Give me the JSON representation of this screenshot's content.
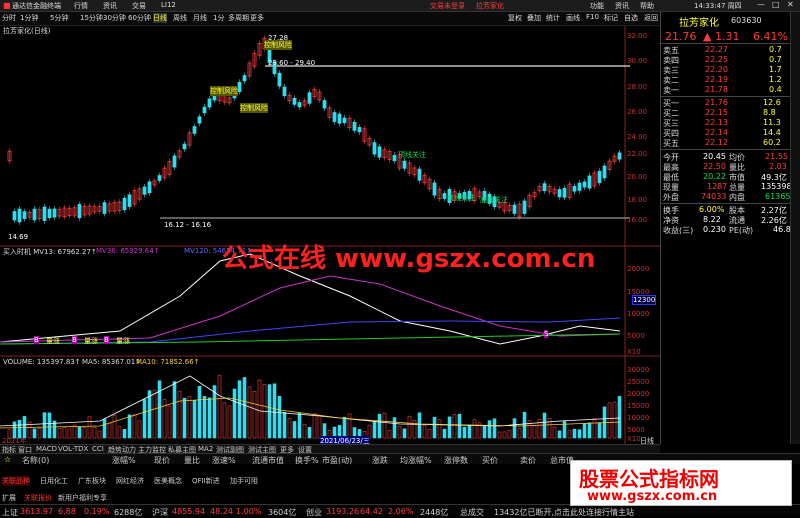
{
  "titlebar": {
    "app": "通达信金融终端",
    "menus": [
      "行情",
      "资讯",
      "交易",
      "LI12"
    ],
    "center1": "交易未登录",
    "center2": "拉芳家化",
    "right": [
      "功能",
      "资讯",
      "帮助"
    ],
    "time": "14:33:47 周四"
  },
  "menubar": {
    "left_items": [
      "分时",
      "1分钟",
      "5分钟",
      "15分钟",
      "30分钟",
      "60分钟",
      "日线",
      "周线",
      "月线",
      "1分",
      "多周期",
      "更多"
    ],
    "right_items": [
      "复权",
      "叠加",
      "统计",
      "画线",
      "F10",
      "标记",
      "自选",
      "返回"
    ]
  },
  "chart_title": "拉芳家化(日线)",
  "price_chart": {
    "annotations": [
      "控制风险",
      "控制风险",
      "控制风险",
      "顶线关注",
      "底线关注",
      "底线关注"
    ],
    "peak_label": "27.28",
    "range1": "29.60 - 29.40",
    "range2": "16.12 - 16.16",
    "low_label": "14.69",
    "axis": [
      "32.00",
      "30.00",
      "28.00",
      "26.00",
      "24.00",
      "22.00",
      "20.00",
      "18.00",
      "16.00"
    ],
    "markers": [
      "B",
      "B",
      "S",
      "B",
      "M"
    ]
  },
  "indicator_panel": {
    "header": "买入时机  MV13: 67962.27↑",
    "mv36": "MV36: 65929.64↑",
    "mv120": "MV120: 54654.71↑",
    "axis": [
      "20000",
      "15000",
      "10000",
      "5000",
      "X10"
    ],
    "current": "12300",
    "markers": [
      "B",
      "B",
      "B",
      "B",
      "B",
      "B",
      "S"
    ],
    "labels": [
      "量涨",
      "量涨",
      "量涨"
    ]
  },
  "volume_panel": {
    "header": "VOLUME: 135397.83↑",
    "ma5": "MA5: 85367.01↑",
    "ma10": "MA10: 71852.66↑",
    "axis": [
      "30000",
      "25000",
      "20000",
      "15000",
      "10000",
      "5000",
      "X10"
    ],
    "date_tag": "2021/06/23/三",
    "year_left": "2021年",
    "bottom_right": "日线"
  },
  "tabbar": [
    "指标",
    "窗口",
    "MACD",
    "VOL-TDX",
    "CCI",
    "趋势动力",
    "主力监控",
    "私募主图",
    "MA2",
    "测试副图",
    "测试主图",
    "更多",
    "设置"
  ],
  "colhdr": [
    "名称(0)",
    "涨幅%",
    "现价",
    "量比",
    "涨速%",
    "流通市值",
    "换手%",
    "市盈(动)",
    "涨跌",
    "均涨幅%",
    "涨停数",
    "买价",
    "卖价",
    "总市值"
  ],
  "bottom_tabs": [
    "关联品种",
    "日用化工",
    "广东板块",
    "网红经济",
    "医美概念",
    "QFII新进",
    "加手可阻"
  ],
  "bottom_sub": [
    "扩展",
    "关联报价",
    "新用户福利专享"
  ],
  "stock": {
    "name": "拉芳家化",
    "code": "603630",
    "price": "21.76",
    "change": "1.31",
    "pct": "6.41%"
  },
  "asks": [
    [
      "卖五",
      "22.27",
      "2"
    ],
    [
      "卖四",
      "22.25",
      "7"
    ],
    [
      "卖三",
      "22.20",
      "7"
    ],
    [
      "卖二",
      "22.19",
      "2"
    ],
    [
      "卖一",
      "21.78",
      "4"
    ]
  ],
  "bids": [
    [
      "买一",
      "21.76",
      "12"
    ],
    [
      "买二",
      "22.15",
      "8"
    ],
    [
      "买三",
      "22.13",
      "11"
    ],
    [
      "买四",
      "22.14",
      "14"
    ],
    [
      "买五",
      "22.12",
      "60"
    ]
  ],
  "ask_ext": [
    "0.7",
    "0.7",
    "1.7",
    "1.2",
    "0.4"
  ],
  "bid_ext": [
    "12.6",
    "8.8",
    "11.3",
    "14.4",
    "60.2"
  ],
  "stats": [
    [
      "今开",
      "20.45",
      "均价",
      "21.55"
    ],
    [
      "最高",
      "22.50",
      "量比",
      "2.03"
    ],
    [
      "最低",
      "20.22",
      "市值",
      "49.3亿"
    ],
    [
      "现量",
      "1287",
      "总量",
      "135398"
    ],
    [
      "外盘",
      "74033",
      "内盘",
      "61365"
    ],
    [
      "换手",
      "6.00%",
      "股本",
      "2.27亿"
    ],
    [
      "净资",
      "8.22",
      "流通",
      "2.26亿"
    ],
    [
      "收益(三)",
      "0.230",
      "PE(动)",
      "46.8"
    ]
  ],
  "status": {
    "sh_label": "上证",
    "sh": "3613.97",
    "sh_chg": "6.88",
    "sh_pct": "0.19%",
    "sh_amt": "6288亿",
    "sz_label": "沪深",
    "sz": "4855.94",
    "sz_chg": "48.24",
    "sz_pct": "1.00%",
    "sz_amt": "3604亿",
    "cy_label": "创业",
    "cy": "3193.26",
    "cy_chg": "64.42",
    "cy_pct": "2.06%",
    "cy_amt": "2448亿",
    "total": "总成交",
    "total_amt": "13432亿已断开,点击此处连接行情主站"
  },
  "watermark": "公式在线 www.gszx.com.cn",
  "ad": {
    "line1": "股票公式指标网",
    "line2": "www.gszx.com.cn"
  },
  "colors": {
    "up": "#ff3b3b",
    "down": "#00e05a",
    "cyan": "#33ddee",
    "yellow": "#ffff33"
  }
}
